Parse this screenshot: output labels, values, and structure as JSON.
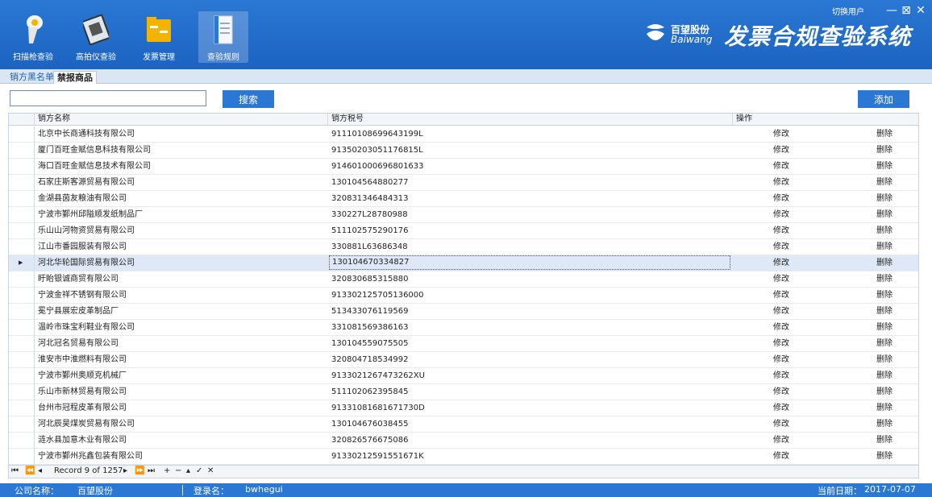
{
  "header": {
    "tools": [
      {
        "label": "扫描枪查验",
        "icon": "barcode-scanner-icon"
      },
      {
        "label": "高拍仪查验",
        "icon": "document-camera-icon"
      },
      {
        "label": "发票管理",
        "icon": "invoice-folder-icon"
      },
      {
        "label": "查验规则",
        "icon": "rules-document-icon"
      }
    ],
    "brand_cn": "百望股份",
    "brand_en": "Baiwang",
    "app_title": "发票合规查验系统",
    "switch_user": "切换用户",
    "accent": "#2a78d4"
  },
  "tabs": [
    "销方黑名单",
    "禁报商品"
  ],
  "search": {
    "value": "",
    "button": "搜索",
    "add_button": "添加"
  },
  "grid": {
    "columns": [
      "销方名称",
      "销方税号",
      "操作"
    ],
    "edit_label": "修改",
    "delete_label": "删除",
    "rows": [
      {
        "name": "北京中长商通科技有限公司",
        "tax": "91110108699643199L"
      },
      {
        "name": "厦门百旺金赋信息科技有限公司",
        "tax": "91350203051176815L"
      },
      {
        "name": "海口百旺金赋信息技术有限公司",
        "tax": "914601000696801633"
      },
      {
        "name": "石家庄斯客源贸易有限公司",
        "tax": "130104564880277"
      },
      {
        "name": "金湖县茵友粮油有限公司",
        "tax": "320831346484313"
      },
      {
        "name": "宁波市鄞州邱隘顺发纸制品厂",
        "tax": "330227L28780988"
      },
      {
        "name": "乐山山河物资贸易有限公司",
        "tax": "511102575290176"
      },
      {
        "name": "江山市番园服装有限公司",
        "tax": "330881L63686348"
      },
      {
        "name": "河北华轮国际贸易有限公司",
        "tax": "130104670334827"
      },
      {
        "name": "盱眙银诚商贸有限公司",
        "tax": "320830685315880"
      },
      {
        "name": "宁波金祥不锈钢有限公司",
        "tax": "913302125705136000"
      },
      {
        "name": "冕宁县展宏皮革制品厂",
        "tax": "513433076119569"
      },
      {
        "name": "温岭市珠宝利鞋业有限公司",
        "tax": "331081569386163"
      },
      {
        "name": "河北冠名贸易有限公司",
        "tax": "130104559075505"
      },
      {
        "name": "淮安市中淮燃料有限公司",
        "tax": "320804718534992"
      },
      {
        "name": "宁波市鄞州奥顺克机械厂",
        "tax": "9133021267473262XU"
      },
      {
        "name": "乐山市新林贸易有限公司",
        "tax": "511102062395845"
      },
      {
        "name": "台州市冠程皮革有限公司",
        "tax": "91331081681671730D"
      },
      {
        "name": "河北辰昊煤炭贸易有限公司",
        "tax": "130104676038455"
      },
      {
        "name": "涟水县加意木业有限公司",
        "tax": "320826576675086"
      },
      {
        "name": "宁波市鄞州兆鑫包装有限公司",
        "tax": "91330212591551671K"
      }
    ],
    "selected_index": 8
  },
  "navigator": {
    "record_text": "Record 9 of 1257"
  },
  "status": {
    "company_label": "公司名称：",
    "company_value": "百望股份",
    "login_label": "登录名：",
    "login_value": "bwhegui",
    "date_label": "当前日期：",
    "date_value": "2017-07-07"
  }
}
